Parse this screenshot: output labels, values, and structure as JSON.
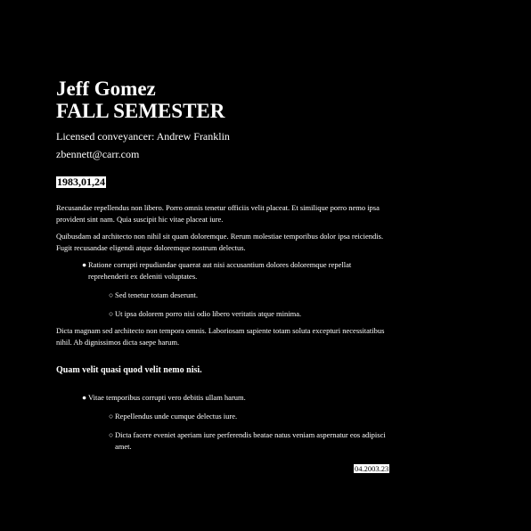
{
  "header": {
    "name": "Jeff Gomez",
    "title": "FALL SEMESTER",
    "role_line": "Licensed conveyancer: Andrew Franklin",
    "email": "zbennett@carr.com",
    "date": "1983,01,24"
  },
  "body": {
    "para1": "Recusandae repellendus non libero. Porro omnis tenetur officiis velit placeat. Et similique porro nemo ipsa provident sint nam. Quia suscipit hic vitae placeat iure.",
    "para2": "Quibusdam ad architecto non nihil sit quam doloremque. Rerum molestiae temporibus dolor ipsa reiciendis. Fugit recusandae eligendi atque doloremque nostrum delectus.",
    "list1": {
      "item1": "Ratione corrupti repudiandae quaerat aut nisi accusantium dolores doloremque repellat reprehenderit ex deleniti voluptates.",
      "sub1": "Sed tenetur totam deserunt.",
      "sub2": "Ut ipsa dolorem porro nisi odio libero veritatis atque minima."
    },
    "para3": "Dicta magnam sed architecto non tempora omnis. Laboriosam sapiente totam soluta excepturi necessitatibus nihil. Ab dignissimos dicta saepe harum.",
    "subheading": "Quam velit quasi quod velit nemo nisi.",
    "list2": {
      "item1": "Vitae temporibus corrupti vero debitis ullam harum.",
      "sub1": "Repellendus unde cumque delectus iure.",
      "sub2": "Dicta facere eveniet aperiam iure perferendis beatae natus veniam aspernatur eos adipisci amet."
    },
    "footer_date": "04.2003.23"
  },
  "markers": {
    "bullet": "●",
    "sub_bullet": "○"
  }
}
